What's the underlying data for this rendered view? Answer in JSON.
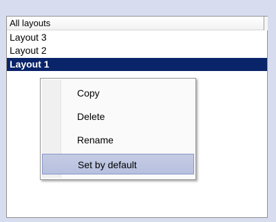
{
  "list": {
    "header": "All layouts",
    "rows": [
      {
        "label": "Layout 3"
      },
      {
        "label": "Layout 2"
      },
      {
        "label": "Layout 1"
      }
    ],
    "selected_index": 2
  },
  "context_menu": {
    "items": [
      {
        "label": "Copy"
      },
      {
        "label": "Delete"
      },
      {
        "label": "Rename"
      },
      {
        "label": "Set by default"
      }
    ],
    "hovered_index": 3
  },
  "colors": {
    "selection": "#0a246a",
    "menu_hover": "#c4cbe3"
  }
}
